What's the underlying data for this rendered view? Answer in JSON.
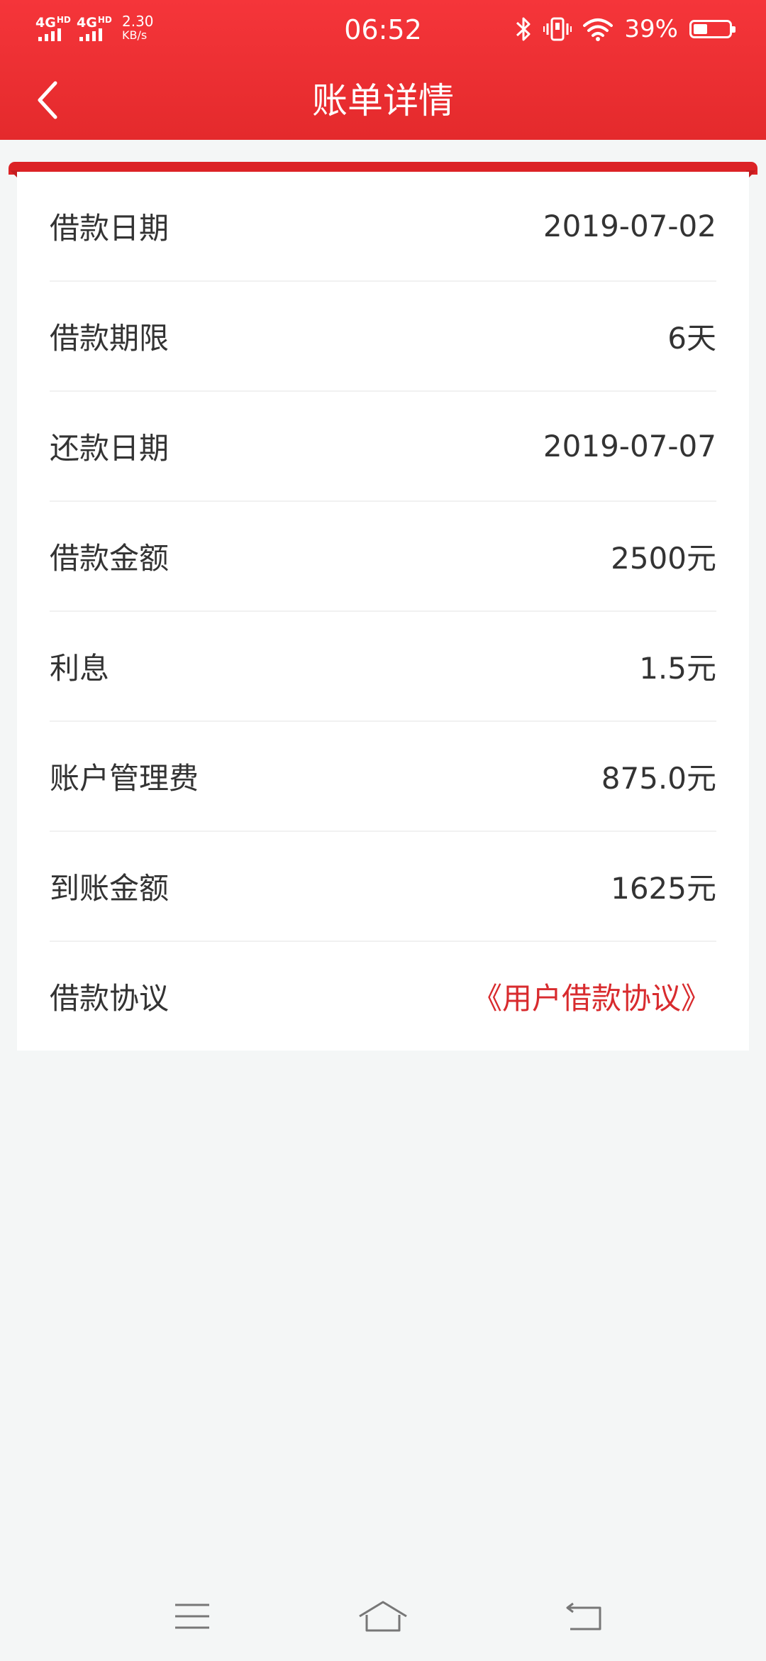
{
  "status_bar": {
    "network_1": "4G",
    "network_1_sup": "HD",
    "network_2": "4G",
    "network_2_sup": "HD",
    "speed_value": "2.30",
    "speed_unit": "KB/s",
    "time": "06:52",
    "battery_percent": "39%",
    "battery_level": 0.39,
    "icons": [
      "bluetooth-icon",
      "vibrate-icon",
      "wifi-icon",
      "battery-icon"
    ]
  },
  "header": {
    "title": "账单详情",
    "back_icon": "chevron-left-icon",
    "background_color": "#e52b2d"
  },
  "bill_details": {
    "rows": [
      {
        "label": "借款日期",
        "value": "2019-07-02"
      },
      {
        "label": "借款期限",
        "value": "6天"
      },
      {
        "label": "还款日期",
        "value": "2019-07-07"
      },
      {
        "label": "借款金额",
        "value": "2500元"
      },
      {
        "label": "利息",
        "value": "1.5元"
      },
      {
        "label": "账户管理费",
        "value": "875.0元"
      },
      {
        "label": "到账金额",
        "value": "1625元"
      },
      {
        "label": "借款协议",
        "value": "《用户借款协议》"
      }
    ],
    "link_color": "#d82b2e"
  },
  "system_nav": {
    "icons": [
      "menu-icon",
      "home-icon",
      "back-icon"
    ]
  }
}
